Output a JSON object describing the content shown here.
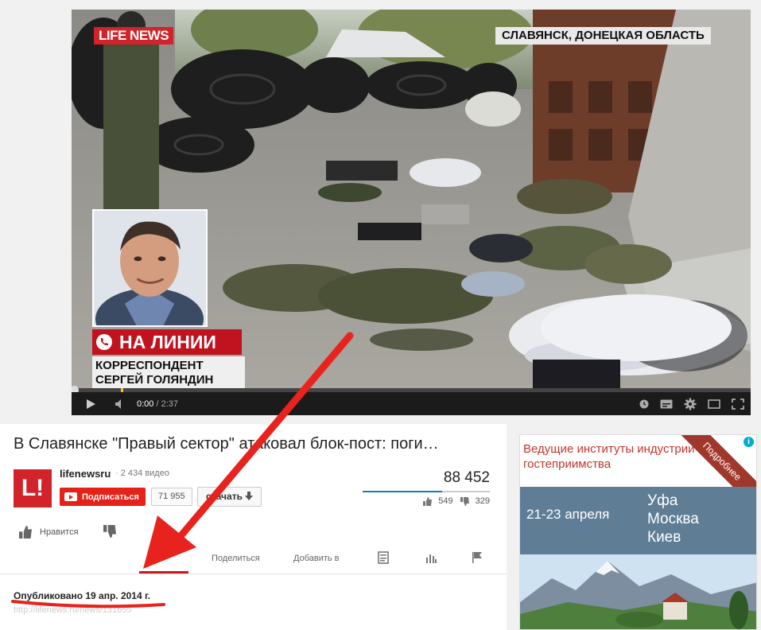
{
  "player": {
    "logo": "LIFE NEWS",
    "location": "СЛАВЯНСК, ДОНЕЦКАЯ ОБЛАСТЬ",
    "on_line_label": "НА ЛИНИИ",
    "reporter_caption_line1": "КОРРЕСПОНДЕНТ",
    "reporter_caption_line2": "СЕРГЕЙ ГОЛЯНДИН",
    "time_current": "0:00",
    "time_duration": "2:37",
    "progress_fraction": 0,
    "icons": [
      "play-icon",
      "volume-icon",
      "watch-later-icon",
      "captions-icon",
      "settings-icon",
      "theater-mode-icon",
      "fullscreen-icon"
    ]
  },
  "video": {
    "title": "В Славянске \"Правый сектор\" атаковал блок-пост: поги…",
    "channel_name": "lifenewsru",
    "video_count": "2 434 видео",
    "subscribe_label": "Подписаться",
    "subscriber_count": "71 955",
    "download_label": "скачать",
    "view_count": "88 452",
    "likes": "549",
    "dislikes": "329",
    "like_label": "Нравится",
    "tabs": {
      "share": "Поделиться",
      "add_to": "Добавить в"
    },
    "published": "Опубликовано 19 апр. 2014 г.",
    "link": "http://lifenews.ru/news/131655"
  },
  "ad": {
    "headline": "Ведущие институты индустрии гостеприимства",
    "ribbon": "Подробнее",
    "dates": "21-23 апреля",
    "city1": "Уфа",
    "city2": "Москва",
    "city3": "Киев"
  },
  "colors": {
    "accent_red": "#e62117",
    "annotation_red": "#e8231d",
    "brand_red": "#d2232a",
    "like_bar": "#167ac6"
  }
}
